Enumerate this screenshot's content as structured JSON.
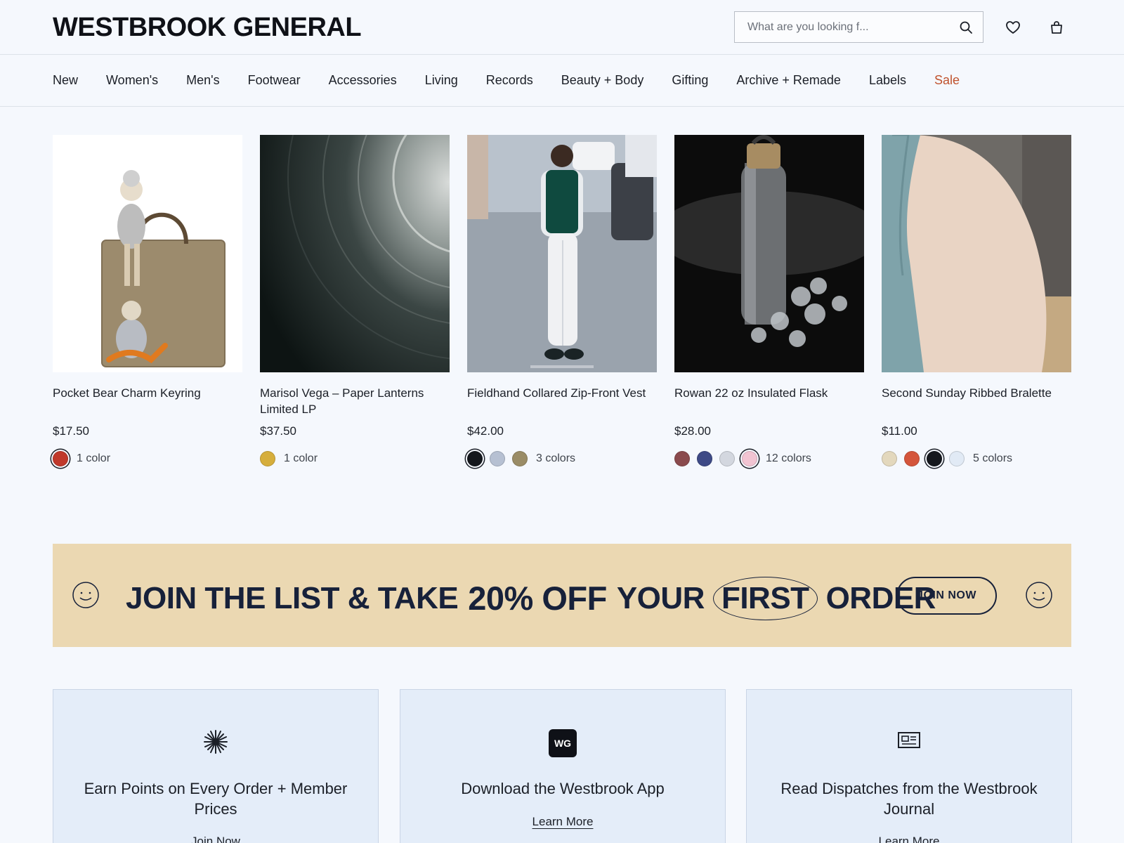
{
  "header": {
    "logo": "WESTBROOK GENERAL",
    "search": {
      "placeholder": "What are you looking f..."
    },
    "icons": [
      "search-icon",
      "heart-icon",
      "bag-icon"
    ]
  },
  "nav": {
    "items": [
      "New",
      "Women's",
      "Men's",
      "Footwear",
      "Accessories",
      "Living",
      "Records",
      "Beauty + Body",
      "Gifting",
      "Archive + Remade",
      "Labels",
      "Sale"
    ]
  },
  "products": [
    {
      "name": "Pocket Bear Charm Keyring",
      "price": "$17.50",
      "swatches": [
        "#c0392b"
      ],
      "selected": 0,
      "colors": "1 color"
    },
    {
      "name": "Marisol Vega – Paper Lanterns Limited LP",
      "price": "$37.50",
      "swatches": [
        "#d6ae3c"
      ],
      "selected": -1,
      "colors": "1 color"
    },
    {
      "name": "Fieldhand Collared Zip-Front Vest",
      "price": "$42.00",
      "swatches": [
        "#15181d",
        "#b6c0d2",
        "#9a8c66"
      ],
      "selected": 0,
      "colors": "3 colors"
    },
    {
      "name": "Rowan 22 oz Insulated Flask",
      "price": "$28.00",
      "swatches": [
        "#8a4a4d",
        "#3e4a86",
        "#d3d7df",
        "#f2c4d2"
      ],
      "selected": 3,
      "colors": "12 colors"
    },
    {
      "name": "Second Sunday Ribbed Bralette",
      "price": "$11.00",
      "swatches": [
        "#e3d8bd",
        "#d4553b",
        "#15181d",
        "#e1eaf5"
      ],
      "selected": 2,
      "colors": "5 colors"
    }
  ],
  "promo": {
    "text_1": "JOIN THE LIST & TAKE",
    "text_2": "20% OFF",
    "text_3": "YOUR",
    "text_4": "FIRST",
    "text_5": "ORDER",
    "button": "JOIN NOW"
  },
  "features": [
    {
      "icon": "sparkle-icon",
      "title": "Earn Points on Every Order + Member Prices",
      "link": "Join Now"
    },
    {
      "icon": "wg-app-icon",
      "icon_text": "WG",
      "title": "Download the Westbrook App",
      "link": "Learn More"
    },
    {
      "icon": "newspaper-icon",
      "title": "Read Dispatches from the Westbrook Journal",
      "link": "Learn More"
    }
  ]
}
